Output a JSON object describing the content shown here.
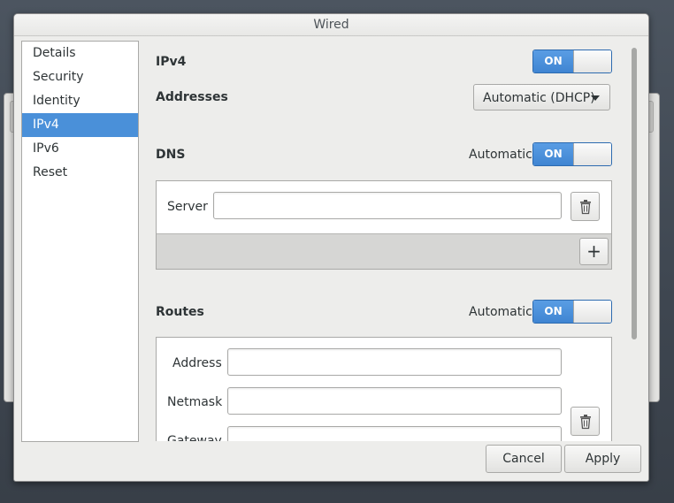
{
  "window": {
    "title": "Wired"
  },
  "sidebar": {
    "items": [
      {
        "label": "Details",
        "selected": false
      },
      {
        "label": "Security",
        "selected": false
      },
      {
        "label": "Identity",
        "selected": false
      },
      {
        "label": "IPv4",
        "selected": true
      },
      {
        "label": "IPv6",
        "selected": false
      },
      {
        "label": "Reset",
        "selected": false
      }
    ]
  },
  "ipv4": {
    "label": "IPv4",
    "toggle": "ON",
    "addresses_label": "Addresses",
    "addresses_value": "Automatic (DHCP)"
  },
  "dns": {
    "label": "DNS",
    "automatic_label": "Automatic",
    "toggle": "ON",
    "server_label": "Server",
    "server_value": "",
    "add_label": "+"
  },
  "routes": {
    "label": "Routes",
    "automatic_label": "Automatic",
    "toggle": "ON",
    "address_label": "Address",
    "netmask_label": "Netmask",
    "gateway_label": "Gateway",
    "address_value": "",
    "netmask_value": "",
    "gateway_value": ""
  },
  "footer": {
    "cancel_label": "Cancel",
    "apply_label": "Apply"
  },
  "colors": {
    "accent": "#4a90d9",
    "toggle_on": "#3f85d2"
  }
}
